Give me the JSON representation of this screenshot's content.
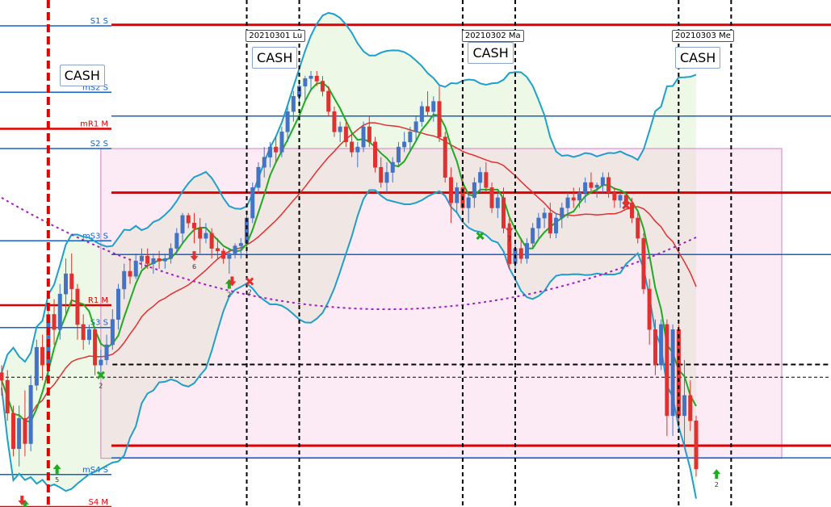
{
  "chart_data": {
    "type": "candlestick",
    "ylim": [
      0,
      100
    ],
    "x_count": 150,
    "colors": {
      "up_candle": "#4472c4",
      "down_candle": "#e03030",
      "upper_band": "#1f9fc9",
      "middle_band": "#e03030",
      "fast_ma": "#1faa1f",
      "slow_ma_dotted": "#a020c0",
      "band_fill": "#e8f8e0",
      "pink_zone": "#f6c6e2",
      "red_level": "#e00000",
      "blue_level": "#1560c8",
      "session_line": "#000000"
    },
    "levels": [
      {
        "label": "S1 S",
        "y": 94.9,
        "color": "blue",
        "extends": "left"
      },
      {
        "label": "",
        "y": 95.1,
        "color": "red",
        "extends": "right"
      },
      {
        "label": "mS2 S",
        "y": 81.8,
        "color": "blue",
        "extends": "left"
      },
      {
        "label": "",
        "y": 77.1,
        "color": "blue",
        "extends": "right"
      },
      {
        "label": "mR1 M",
        "y": 74.6,
        "color": "red",
        "extends": "left"
      },
      {
        "label": "S2 S",
        "y": 70.7,
        "color": "blue",
        "extends": "left"
      },
      {
        "label": "",
        "y": 62.0,
        "color": "red",
        "extends": "right"
      },
      {
        "label": "mS3 S",
        "y": 52.5,
        "color": "blue",
        "extends": "left"
      },
      {
        "label": "",
        "y": 49.8,
        "color": "blue",
        "extends": "right"
      },
      {
        "label": "R1 M",
        "y": 39.8,
        "color": "red",
        "extends": "left"
      },
      {
        "label": "S3 S",
        "y": 35.4,
        "color": "blue",
        "extends": "left"
      },
      {
        "label": "",
        "y": 12.1,
        "color": "red",
        "extends": "right"
      },
      {
        "label": "",
        "y": 9.7,
        "color": "blue",
        "extends": "right"
      },
      {
        "label": "mS4 S",
        "y": 6.4,
        "color": "blue",
        "extends": "left"
      },
      {
        "label": "S4 M",
        "y": 0.0,
        "color": "red",
        "extends": "left"
      }
    ],
    "pink_zone": {
      "x_from": 17,
      "x_to": 128,
      "y_from": 9.6,
      "y_to": 70.7
    },
    "session_lines_x": [
      42,
      51,
      79,
      88,
      116,
      125
    ],
    "red_session_line_x": 8,
    "dashed_levels": [
      {
        "y": 28.1,
        "x_from": 19,
        "x_to": 150,
        "style": "bold-dashed"
      },
      {
        "y": 25.6,
        "x_from": 0,
        "x_to": 150,
        "style": "thin-dashed"
      }
    ],
    "date_labels": [
      {
        "text": "20210301 Lu",
        "x": 46
      },
      {
        "text": "20210302 Ma",
        "x": 83
      },
      {
        "text": "20210303 Me",
        "x": 119
      }
    ],
    "cash_labels": [
      {
        "text": "CASH",
        "x": 13.5,
        "y": 85
      },
      {
        "text": "CASH",
        "x": 46.5,
        "y": 88.5
      },
      {
        "text": "CASH",
        "x": 83.5,
        "y": 89.5
      },
      {
        "text": "CASH",
        "x": 119,
        "y": 88.5
      }
    ],
    "markers": [
      {
        "type": "arrow-up",
        "x": 4,
        "y": 0.5,
        "color": "#1faa1f"
      },
      {
        "type": "arrow-down",
        "x": 3.5,
        "y": 1.3,
        "color": "#e03030"
      },
      {
        "type": "arrow-up",
        "x": 9.5,
        "y": 7.5,
        "color": "#1faa1f",
        "label": "5"
      },
      {
        "type": "cross",
        "x": 17,
        "y": 26.0,
        "color": "#1faa1f",
        "label": "2"
      },
      {
        "type": "arrow-down",
        "x": 33,
        "y": 49.5,
        "color": "#e03030",
        "label": "6"
      },
      {
        "type": "arrow-up",
        "x": 39,
        "y": 44,
        "color": "#1faa1f",
        "label": "2"
      },
      {
        "type": "arrow-down",
        "x": 39.5,
        "y": 44.5,
        "color": "#e03030"
      },
      {
        "type": "cross",
        "x": 42.5,
        "y": 44.5,
        "color": "#e03030",
        "label": "2"
      },
      {
        "type": "cross",
        "x": 82,
        "y": 53.5,
        "color": "#1faa1f"
      },
      {
        "type": "arrow-down",
        "x": 87,
        "y": 55,
        "color": "#e03030",
        "label": "7"
      },
      {
        "type": "cross",
        "x": 107,
        "y": 59.5,
        "color": "#e03030"
      },
      {
        "type": "arrow-up",
        "x": 122.5,
        "y": 6.5,
        "color": "#1faa1f",
        "label": "2"
      }
    ],
    "candles": [
      [
        26.5,
        28,
        22,
        25
      ],
      [
        25,
        27,
        17,
        18.5
      ],
      [
        18.5,
        20,
        10,
        11.5
      ],
      [
        11.5,
        20,
        8,
        17.5
      ],
      [
        17.5,
        23,
        10,
        12.5
      ],
      [
        12.5,
        26,
        11,
        24
      ],
      [
        24,
        33,
        23,
        31.5
      ],
      [
        31.5,
        34,
        25,
        28
      ],
      [
        28,
        39,
        25,
        38
      ],
      [
        38,
        41,
        32,
        35
      ],
      [
        35,
        44,
        33,
        42
      ],
      [
        42,
        49,
        38,
        46
      ],
      [
        46,
        50,
        40,
        43
      ],
      [
        43,
        44,
        33,
        36
      ],
      [
        36,
        38,
        31,
        33
      ],
      [
        33,
        36,
        32,
        35
      ],
      [
        35,
        35,
        26,
        28
      ],
      [
        28,
        31,
        26,
        29
      ],
      [
        29,
        34,
        28,
        32
      ],
      [
        32,
        39,
        31,
        37
      ],
      [
        37,
        44,
        35,
        43
      ],
      [
        43,
        48,
        41,
        46.5
      ],
      [
        46.5,
        49,
        44,
        45.5
      ],
      [
        45.5,
        50,
        45,
        48.5
      ],
      [
        48.5,
        51,
        47,
        49.5
      ],
      [
        49.5,
        51,
        47,
        48
      ],
      [
        48,
        50,
        46,
        49
      ],
      [
        49,
        50.5,
        47,
        48.5
      ],
      [
        48.5,
        50,
        47,
        49
      ],
      [
        49,
        52,
        48,
        51
      ],
      [
        51,
        55,
        50,
        54
      ],
      [
        54,
        58,
        52,
        57.5
      ],
      [
        57.5,
        58,
        55,
        56
      ],
      [
        56,
        58,
        52,
        55
      ],
      [
        55,
        57,
        50,
        53
      ],
      [
        53,
        56,
        52,
        54
      ],
      [
        54,
        55,
        49,
        51
      ],
      [
        51,
        53,
        49,
        50.5
      ],
      [
        50.5,
        51,
        48,
        49
      ],
      [
        49,
        51,
        46,
        50
      ],
      [
        50,
        52,
        49,
        51.5
      ],
      [
        51.5,
        53,
        49,
        52
      ],
      [
        52,
        58,
        50,
        57
      ],
      [
        57,
        64,
        56,
        63
      ],
      [
        63,
        68,
        62,
        67
      ],
      [
        67,
        71,
        65,
        69
      ],
      [
        69,
        72,
        67,
        71
      ],
      [
        71,
        73,
        68,
        70
      ],
      [
        70,
        75,
        69,
        74
      ],
      [
        74,
        79,
        72,
        78
      ],
      [
        78,
        82,
        76,
        81
      ],
      [
        81,
        84,
        79,
        83
      ],
      [
        83,
        85,
        80,
        84.5
      ],
      [
        84.5,
        86,
        82,
        85
      ],
      [
        85,
        86,
        83,
        84
      ],
      [
        84,
        85,
        81,
        82
      ],
      [
        82,
        83,
        77,
        78
      ],
      [
        78,
        79,
        73,
        74
      ],
      [
        74,
        76,
        72,
        75
      ],
      [
        75,
        76,
        71,
        72
      ],
      [
        72,
        74,
        69,
        70
      ],
      [
        70,
        72,
        67,
        71
      ],
      [
        71,
        76,
        70,
        75
      ],
      [
        75,
        77,
        71,
        72
      ],
      [
        72,
        73,
        66,
        67
      ],
      [
        67,
        69,
        63,
        64
      ],
      [
        64,
        68,
        62,
        66
      ],
      [
        66,
        69,
        64,
        68
      ],
      [
        68,
        72,
        67,
        71
      ],
      [
        71,
        74,
        70,
        72
      ],
      [
        72,
        75,
        70,
        74
      ],
      [
        74,
        77,
        72,
        76
      ],
      [
        76,
        80,
        75,
        79
      ],
      [
        79,
        82,
        77,
        78
      ],
      [
        78,
        81,
        76,
        80
      ],
      [
        80,
        83,
        72,
        73
      ],
      [
        73,
        74,
        64,
        65
      ],
      [
        65,
        67,
        56,
        60
      ],
      [
        60,
        64,
        58,
        63
      ],
      [
        63,
        65,
        58,
        59
      ],
      [
        59,
        62,
        56,
        61
      ],
      [
        61,
        65,
        59,
        64
      ],
      [
        64,
        67,
        62,
        66
      ],
      [
        66,
        68,
        62,
        63
      ],
      [
        63,
        64,
        58,
        59
      ],
      [
        59,
        62,
        57,
        61
      ],
      [
        61,
        63,
        54,
        55
      ],
      [
        55,
        57,
        47,
        48
      ],
      [
        48,
        52,
        47,
        51
      ],
      [
        51,
        53,
        48,
        49
      ],
      [
        49,
        53,
        48,
        52
      ],
      [
        52,
        56,
        51,
        55
      ],
      [
        55,
        58,
        53,
        57
      ],
      [
        57,
        59,
        55,
        58
      ],
      [
        58,
        60,
        53,
        54
      ],
      [
        54,
        58,
        53,
        57
      ],
      [
        57,
        60,
        55,
        59
      ],
      [
        59,
        62,
        57,
        61
      ],
      [
        61,
        63,
        59,
        60.5
      ],
      [
        60.5,
        63,
        59,
        62
      ],
      [
        62,
        65,
        60,
        64
      ],
      [
        64,
        66,
        62,
        63
      ],
      [
        63,
        64,
        61,
        63.5
      ],
      [
        63.5,
        66,
        62,
        65
      ],
      [
        65,
        66,
        61,
        62
      ],
      [
        62,
        63,
        59,
        60.5
      ],
      [
        60.5,
        62,
        59,
        61.5
      ],
      [
        61.5,
        62,
        59,
        60
      ],
      [
        60,
        61,
        56,
        57
      ],
      [
        57,
        58,
        52,
        53
      ],
      [
        53,
        54,
        42,
        43
      ],
      [
        43,
        45,
        32,
        35
      ],
      [
        35,
        37,
        26,
        28
      ],
      [
        28,
        37,
        27,
        36
      ],
      [
        36,
        37,
        14,
        18
      ],
      [
        18,
        36,
        14,
        35
      ],
      [
        35,
        36,
        16,
        18
      ],
      [
        18,
        29,
        12,
        22
      ],
      [
        22,
        25,
        15,
        17
      ],
      [
        17,
        18,
        6,
        7.5
      ]
    ]
  }
}
